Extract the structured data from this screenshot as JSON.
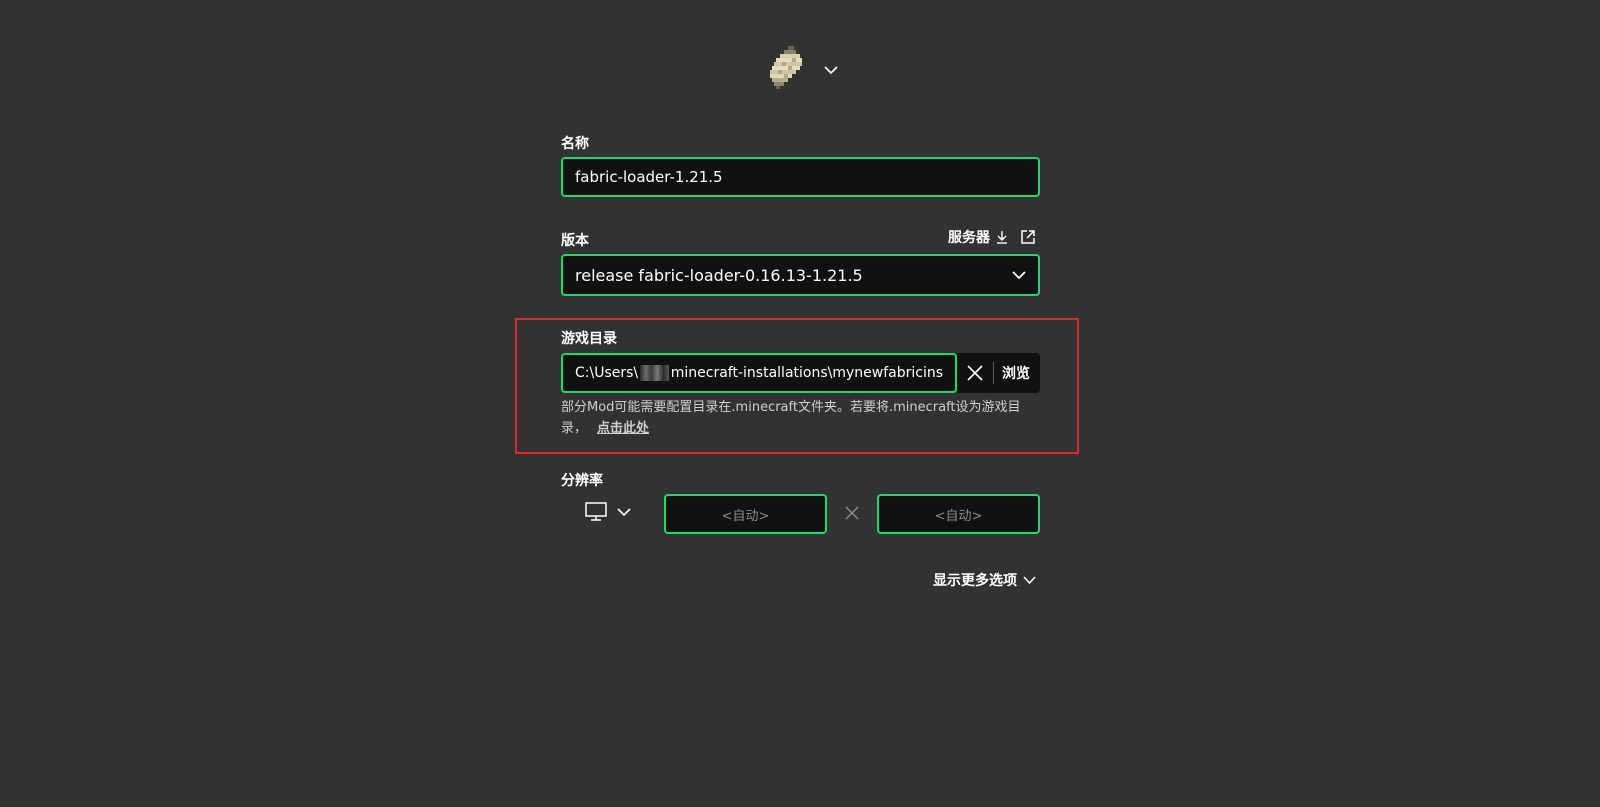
{
  "icon": {
    "name": "paper-scroll-icon"
  },
  "name_field": {
    "label": "名称",
    "value": "fabric-loader-1.21.5"
  },
  "version_field": {
    "label": "版本",
    "value": "release fabric-loader-0.16.13-1.21.5",
    "server_link": "服务器"
  },
  "game_dir": {
    "label": "游戏目录",
    "value_prefix": "C:\\Users\\",
    "value_suffix": "minecraft-installations\\mynewfabricins",
    "browse_label": "浏览",
    "hint_text": "部分Mod可能需要配置目录在.minecraft文件夹。若要将.minecraft设为游戏目录，",
    "hint_link": "点击此处"
  },
  "resolution": {
    "label": "分辨率",
    "width_placeholder": "<自动>",
    "height_placeholder": "<自动>"
  },
  "more_options": {
    "label": "显示更多选项"
  },
  "colors": {
    "background": "#323232",
    "field_bg": "#111111",
    "accent_green": "#1bd96a",
    "highlight_red": "#e0272b"
  }
}
